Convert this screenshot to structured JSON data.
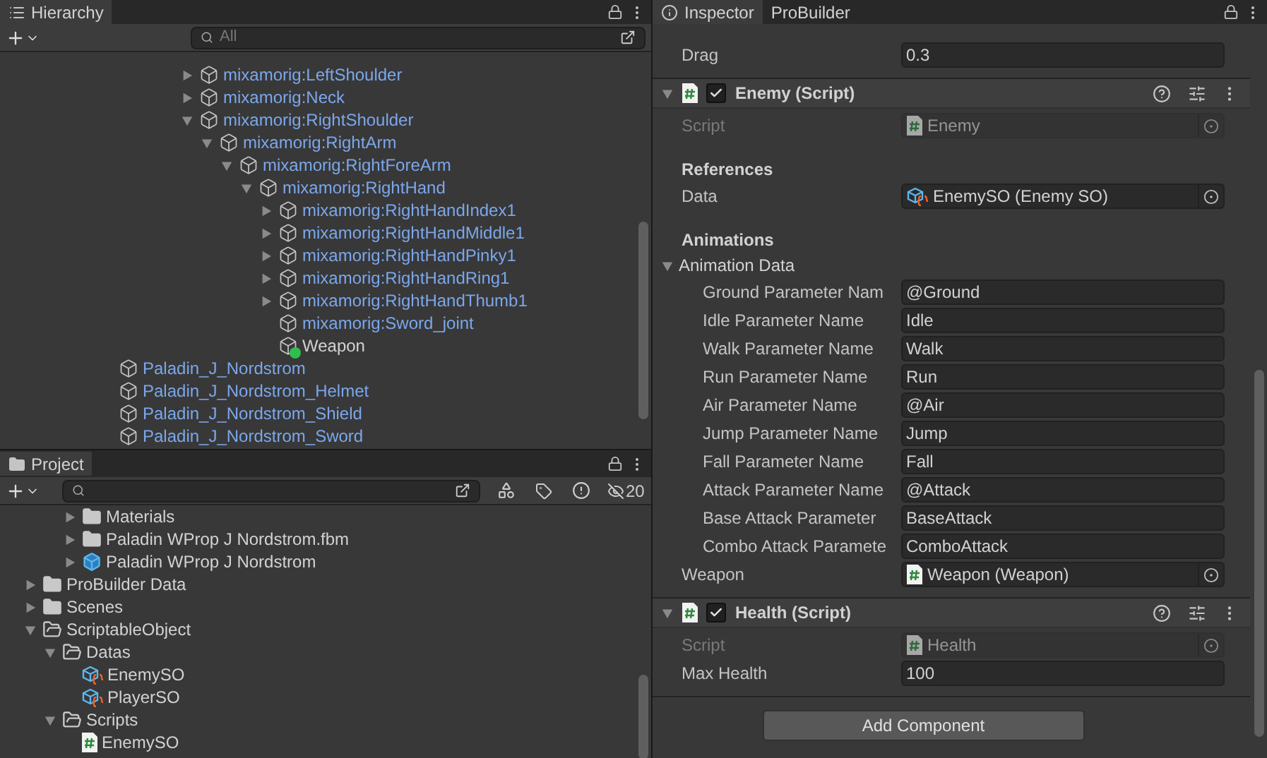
{
  "hierarchy": {
    "tab": {
      "label": "Hierarchy",
      "selected": true
    },
    "search": {
      "placeholder": "All"
    },
    "scrolled_branch": [
      {
        "name": "mixamorig:LeftShoulder",
        "kind": "prefab",
        "expanded": false
      },
      {
        "name": "mixamorig:Neck",
        "kind": "prefab",
        "expanded": false
      },
      {
        "name": "mixamorig:RightShoulder",
        "kind": "prefab",
        "expanded": true,
        "children": [
          {
            "name": "mixamorig:RightArm",
            "kind": "prefab",
            "expanded": true,
            "children": [
              {
                "name": "mixamorig:RightForeArm",
                "kind": "prefab",
                "expanded": true,
                "children": [
                  {
                    "name": "mixamorig:RightHand",
                    "kind": "prefab",
                    "expanded": true,
                    "children": [
                      {
                        "name": "mixamorig:RightHandIndex1",
                        "kind": "prefab",
                        "expanded": false
                      },
                      {
                        "name": "mixamorig:RightHandMiddle1",
                        "kind": "prefab",
                        "expanded": false
                      },
                      {
                        "name": "mixamorig:RightHandPinky1",
                        "kind": "prefab",
                        "expanded": false
                      },
                      {
                        "name": "mixamorig:RightHandRing1",
                        "kind": "prefab",
                        "expanded": false
                      },
                      {
                        "name": "mixamorig:RightHandThumb1",
                        "kind": "prefab",
                        "expanded": false
                      },
                      {
                        "name": "mixamorig:Sword_joint",
                        "kind": "prefab_leaf"
                      },
                      {
                        "name": "Weapon",
                        "kind": "added"
                      }
                    ]
                  }
                ]
              }
            ]
          }
        ]
      }
    ],
    "scene_objects": [
      {
        "name": "Paladin_J_Nordstrom",
        "kind": "prefab_leaf"
      },
      {
        "name": "Paladin_J_Nordstrom_Helmet",
        "kind": "prefab_leaf"
      },
      {
        "name": "Paladin_J_Nordstrom_Shield",
        "kind": "prefab_leaf"
      },
      {
        "name": "Paladin_J_Nordstrom_Sword",
        "kind": "prefab_leaf"
      }
    ]
  },
  "project": {
    "tab": {
      "label": "Project",
      "selected": true
    },
    "hidden_count": "20",
    "scrolled_branch": [
      {
        "name": "Materials",
        "kind": "folder",
        "expanded": false
      },
      {
        "name": "Paladin WProp J Nordstrom.fbm",
        "kind": "folder",
        "expanded": false
      },
      {
        "name": "Paladin WProp J Nordstrom",
        "kind": "model",
        "expanded": false
      }
    ],
    "folders": [
      {
        "name": "ProBuilder Data",
        "kind": "folder",
        "expanded": false
      },
      {
        "name": "Scenes",
        "kind": "folder",
        "expanded": false
      },
      {
        "name": "ScriptableObject",
        "kind": "folder",
        "expanded": true,
        "children": [
          {
            "name": "Datas",
            "kind": "folder",
            "expanded": true,
            "children": [
              {
                "name": "EnemySO",
                "kind": "asset"
              },
              {
                "name": "PlayerSO",
                "kind": "asset"
              }
            ]
          },
          {
            "name": "Scripts",
            "kind": "folder",
            "expanded": true,
            "children": [
              {
                "name": "EnemySO",
                "kind": "script"
              }
            ]
          }
        ]
      }
    ]
  },
  "inspector": {
    "tabs": [
      {
        "label": "Inspector",
        "selected": true
      },
      {
        "label": "ProBuilder",
        "selected": false
      }
    ],
    "components": [
      {
        "kind": "partial",
        "properties": [
          {
            "kind": "text",
            "label": "Drag",
            "value": "0.3"
          }
        ]
      },
      {
        "kind": "script",
        "title": "Enemy (Script)",
        "enabled": true,
        "expanded": true,
        "properties": [
          {
            "kind": "script_ref",
            "label": "Script",
            "value": "Enemy",
            "disabled": true
          },
          {
            "kind": "heading",
            "label": "References"
          },
          {
            "kind": "asset_ref",
            "label": "Data",
            "value": "EnemySO (Enemy SO)",
            "disabled": false
          },
          {
            "kind": "heading",
            "label": "Animations"
          },
          {
            "kind": "foldout",
            "label": "Animation Data",
            "expanded": true,
            "children": [
              {
                "kind": "text",
                "label": "Ground Parameter Nam",
                "value": "@Ground"
              },
              {
                "kind": "text",
                "label": "Idle Parameter Name",
                "value": "Idle"
              },
              {
                "kind": "text",
                "label": "Walk Parameter Name",
                "value": "Walk"
              },
              {
                "kind": "text",
                "label": "Run Parameter Name",
                "value": "Run"
              },
              {
                "kind": "text",
                "label": "Air Parameter Name",
                "value": "@Air"
              },
              {
                "kind": "text",
                "label": "Jump Parameter Name",
                "value": "Jump"
              },
              {
                "kind": "text",
                "label": "Fall Parameter Name",
                "value": "Fall"
              },
              {
                "kind": "text",
                "label": "Attack Parameter Name",
                "value": "@Attack"
              },
              {
                "kind": "text",
                "label": "Base Attack Parameter",
                "value": "BaseAttack"
              },
              {
                "kind": "text",
                "label": "Combo Attack Paramete",
                "value": "ComboAttack"
              }
            ]
          },
          {
            "kind": "script_ref",
            "label": "Weapon",
            "value": "Weapon (Weapon)",
            "disabled": false
          }
        ]
      },
      {
        "kind": "script",
        "title": "Health (Script)",
        "enabled": true,
        "expanded": true,
        "properties": [
          {
            "kind": "script_ref",
            "label": "Script",
            "value": "Health",
            "disabled": true
          },
          {
            "kind": "text",
            "label": "Max Health",
            "value": "100"
          }
        ]
      }
    ],
    "add_button": "Add Component"
  }
}
